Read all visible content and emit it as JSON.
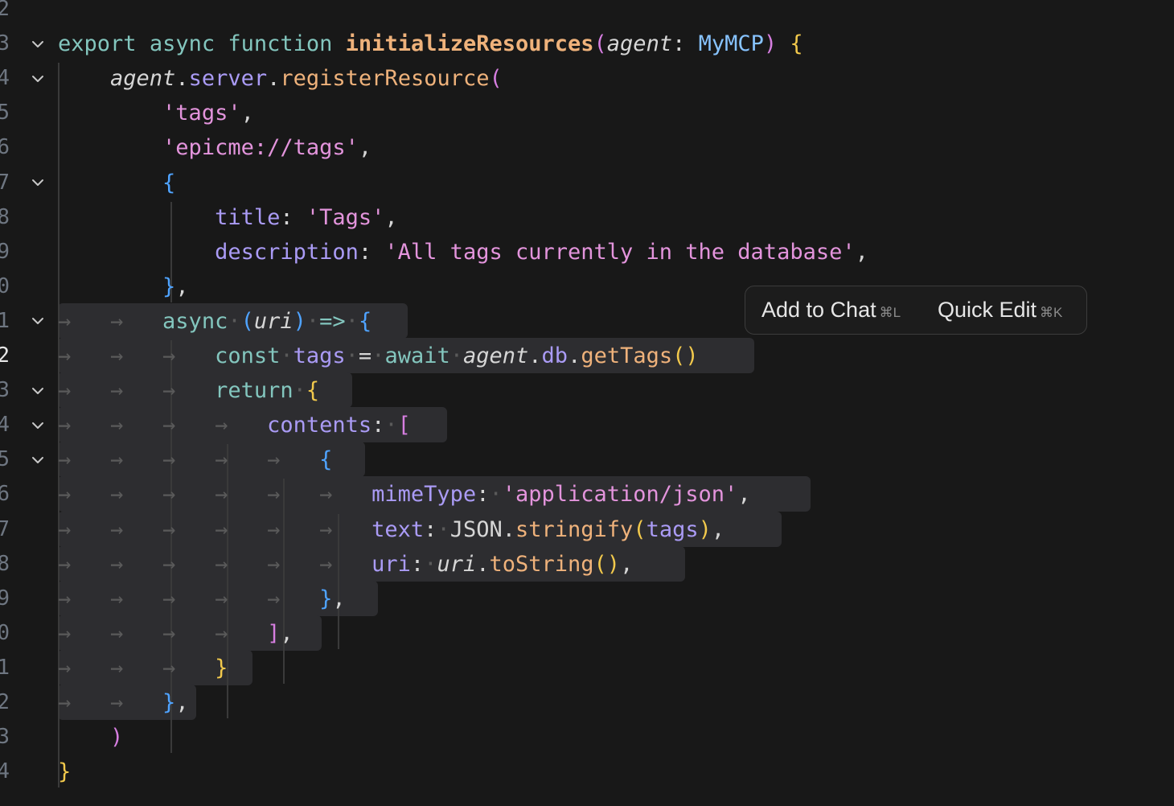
{
  "editor": {
    "gutter_numbers": [
      "2",
      "3",
      "4",
      "5",
      "6",
      "7",
      "8",
      "9",
      "0",
      "1",
      "2",
      "3",
      "4",
      "5",
      "6",
      "7",
      "8",
      "9",
      "0",
      "1",
      "2",
      "3",
      "4"
    ],
    "active_line_index": 9,
    "lines": [
      {
        "tokens": []
      },
      {
        "tokens": [
          [
            "kw",
            "export"
          ],
          [
            "plain",
            " "
          ],
          [
            "kw",
            "async"
          ],
          [
            "plain",
            " "
          ],
          [
            "kw",
            "function"
          ],
          [
            "plain",
            " "
          ],
          [
            "fn-def",
            "initializeResources"
          ],
          [
            "brace-p",
            "("
          ],
          [
            "param",
            "agent"
          ],
          [
            "punc",
            ": "
          ],
          [
            "type",
            "MyMCP"
          ],
          [
            "brace-p",
            ")"
          ],
          [
            "plain",
            " "
          ],
          [
            "brace-y",
            "{"
          ]
        ]
      },
      {
        "tokens": [
          [
            "plain",
            "    "
          ],
          [
            "param",
            "agent"
          ],
          [
            "punc",
            "."
          ],
          [
            "prop",
            "server"
          ],
          [
            "punc",
            "."
          ],
          [
            "fn",
            "registerResource"
          ],
          [
            "brace-p",
            "("
          ]
        ]
      },
      {
        "tokens": [
          [
            "plain",
            "        "
          ],
          [
            "str",
            "'tags'"
          ],
          [
            "punc",
            ","
          ]
        ]
      },
      {
        "tokens": [
          [
            "plain",
            "        "
          ],
          [
            "str",
            "'epicme://tags'"
          ],
          [
            "punc",
            ","
          ]
        ]
      },
      {
        "tokens": [
          [
            "plain",
            "        "
          ],
          [
            "brace-b",
            "{"
          ]
        ]
      },
      {
        "tokens": [
          [
            "plain",
            "            "
          ],
          [
            "prop",
            "title"
          ],
          [
            "punc",
            ": "
          ],
          [
            "str",
            "'Tags'"
          ],
          [
            "punc",
            ","
          ]
        ]
      },
      {
        "tokens": [
          [
            "plain",
            "            "
          ],
          [
            "prop",
            "description"
          ],
          [
            "punc",
            ": "
          ],
          [
            "str",
            "'All tags currently in the database'"
          ],
          [
            "punc",
            ","
          ]
        ]
      },
      {
        "tokens": [
          [
            "plain",
            "        "
          ],
          [
            "brace-b",
            "}"
          ],
          [
            "punc",
            ","
          ]
        ]
      },
      {
        "tokens": [
          [
            "ws",
            "→   →   "
          ],
          [
            "kw",
            "async"
          ],
          [
            "ws",
            "·"
          ],
          [
            "brace-b",
            "("
          ],
          [
            "param",
            "uri"
          ],
          [
            "brace-b",
            ")"
          ],
          [
            "ws",
            "·"
          ],
          [
            "op",
            "=>"
          ],
          [
            "ws",
            "·"
          ],
          [
            "brace-b",
            "{"
          ]
        ]
      },
      {
        "tokens": [
          [
            "ws",
            "→   →   →   "
          ],
          [
            "kw",
            "const"
          ],
          [
            "ws",
            "·"
          ],
          [
            "prop",
            "tags"
          ],
          [
            "ws",
            "·"
          ],
          [
            "punc",
            "="
          ],
          [
            "ws",
            "·"
          ],
          [
            "kw",
            "await"
          ],
          [
            "ws",
            "·"
          ],
          [
            "param",
            "agent"
          ],
          [
            "punc",
            "."
          ],
          [
            "prop",
            "db"
          ],
          [
            "punc",
            "."
          ],
          [
            "fn",
            "getTags"
          ],
          [
            "brace-y",
            "()"
          ]
        ]
      },
      {
        "tokens": [
          [
            "ws",
            "→   →   →   "
          ],
          [
            "kw",
            "return"
          ],
          [
            "ws",
            "·"
          ],
          [
            "brace-y",
            "{"
          ]
        ]
      },
      {
        "tokens": [
          [
            "ws",
            "→   →   →   →   "
          ],
          [
            "prop",
            "contents"
          ],
          [
            "punc",
            ":"
          ],
          [
            "ws",
            "·"
          ],
          [
            "brace-p",
            "["
          ]
        ]
      },
      {
        "tokens": [
          [
            "ws",
            "→   →   →   →   →   "
          ],
          [
            "brace-b",
            "{"
          ]
        ]
      },
      {
        "tokens": [
          [
            "ws",
            "→   →   →   →   →   →   "
          ],
          [
            "prop",
            "mimeType"
          ],
          [
            "punc",
            ":"
          ],
          [
            "ws",
            "·"
          ],
          [
            "str",
            "'application/json'"
          ],
          [
            "punc",
            ","
          ]
        ]
      },
      {
        "tokens": [
          [
            "ws",
            "→   →   →   →   →   →   "
          ],
          [
            "prop",
            "text"
          ],
          [
            "punc",
            ":"
          ],
          [
            "ws",
            "·"
          ],
          [
            "plain",
            "JSON"
          ],
          [
            "punc",
            "."
          ],
          [
            "fn",
            "stringify"
          ],
          [
            "brace-y",
            "("
          ],
          [
            "prop",
            "tags"
          ],
          [
            "brace-y",
            ")"
          ],
          [
            "punc",
            ","
          ]
        ]
      },
      {
        "tokens": [
          [
            "ws",
            "→   →   →   →   →   →   "
          ],
          [
            "prop",
            "uri"
          ],
          [
            "punc",
            ":"
          ],
          [
            "ws",
            "·"
          ],
          [
            "param",
            "uri"
          ],
          [
            "punc",
            "."
          ],
          [
            "fn",
            "toString"
          ],
          [
            "brace-y",
            "()"
          ],
          [
            "punc",
            ","
          ]
        ]
      },
      {
        "tokens": [
          [
            "ws",
            "→   →   →   →   →   "
          ],
          [
            "brace-b",
            "}"
          ],
          [
            "punc",
            ","
          ]
        ]
      },
      {
        "tokens": [
          [
            "ws",
            "→   →   →   →   "
          ],
          [
            "brace-p",
            "]"
          ],
          [
            "punc",
            ","
          ]
        ]
      },
      {
        "tokens": [
          [
            "ws",
            "→   →   →   "
          ],
          [
            "brace-y",
            "}"
          ]
        ]
      },
      {
        "tokens": [
          [
            "ws",
            "→   →   "
          ],
          [
            "brace-b",
            "}"
          ],
          [
            "punc",
            ","
          ]
        ]
      },
      {
        "tokens": [
          [
            "plain",
            "    "
          ],
          [
            "brace-p",
            ")"
          ]
        ]
      },
      {
        "tokens": [
          [
            "brace-y",
            "}"
          ]
        ]
      }
    ],
    "fold_lines": [
      1,
      2,
      5,
      9,
      11,
      12,
      13
    ]
  },
  "tooltip": {
    "add_to_chat": {
      "label": "Add to Chat",
      "shortcut": "⌘L"
    },
    "quick_edit": {
      "label": "Quick Edit",
      "shortcut": "⌘K"
    }
  },
  "icons": {
    "fold": "chevron-down-icon"
  },
  "colors": {
    "background": "#181818",
    "selection": "#2d2d30",
    "keyword": "#83c6be",
    "function": "#efb27b",
    "string": "#e394dc",
    "property": "#aa9bf5",
    "type": "#87c3ff"
  }
}
